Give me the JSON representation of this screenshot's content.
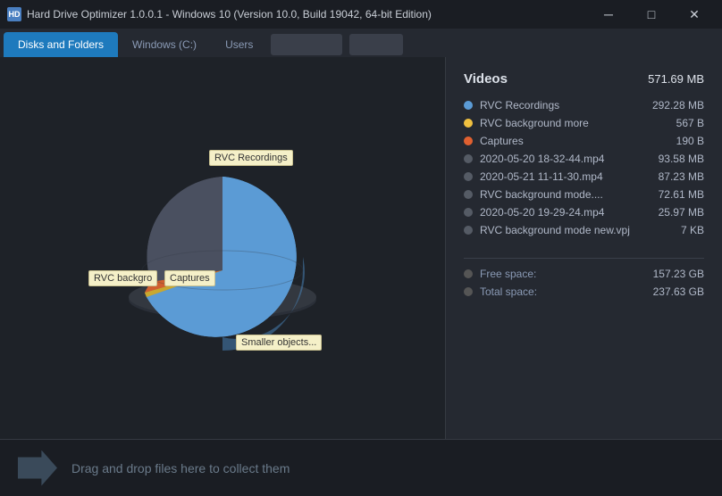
{
  "titlebar": {
    "title": "Hard Drive Optimizer 1.0.0.1 - Windows 10 (Version 10.0, Build 19042, 64-bit Edition)",
    "icon_label": "HD",
    "min_btn": "─",
    "max_btn": "□",
    "close_btn": "✕"
  },
  "tabs": {
    "items": [
      {
        "id": "disks",
        "label": "Disks and Folders",
        "active": true
      },
      {
        "id": "windows",
        "label": "Windows (C:)",
        "active": false
      },
      {
        "id": "users",
        "label": "Users",
        "active": false
      }
    ]
  },
  "chart": {
    "labels": {
      "rvc_recordings": "RVC Recordings",
      "rvc_background": "RVC backgro",
      "captures": "Captures",
      "smaller": "Smaller objects..."
    }
  },
  "right_panel": {
    "section_title": "Videos",
    "section_size": "571.69 MB",
    "items": [
      {
        "color": "#5b9bd5",
        "name": "RVC Recordings",
        "size": "292.28 MB"
      },
      {
        "color": "#f0c040",
        "name": "RVC background more",
        "size": "567 B"
      },
      {
        "color": "#e06030",
        "name": "Captures",
        "size": "190 B"
      },
      {
        "color": "#555b65",
        "name": "2020-05-20 18-32-44.mp4",
        "size": "93.58 MB"
      },
      {
        "color": "#555b65",
        "name": "2020-05-21 11-11-30.mp4",
        "size": "87.23 MB"
      },
      {
        "color": "#555b65",
        "name": "RVC background mode....",
        "size": "72.61 MB"
      },
      {
        "color": "#555b65",
        "name": "2020-05-20 19-29-24.mp4",
        "size": "25.97 MB"
      },
      {
        "color": "#555b65",
        "name": "RVC background mode new.vpj",
        "size": "7 KB"
      }
    ],
    "space": [
      {
        "label": "Free space:",
        "size": "157.23 GB"
      },
      {
        "label": "Total space:",
        "size": "237.63 GB"
      }
    ]
  },
  "drop_zone": {
    "text": "Drag and drop files here to collect them"
  }
}
